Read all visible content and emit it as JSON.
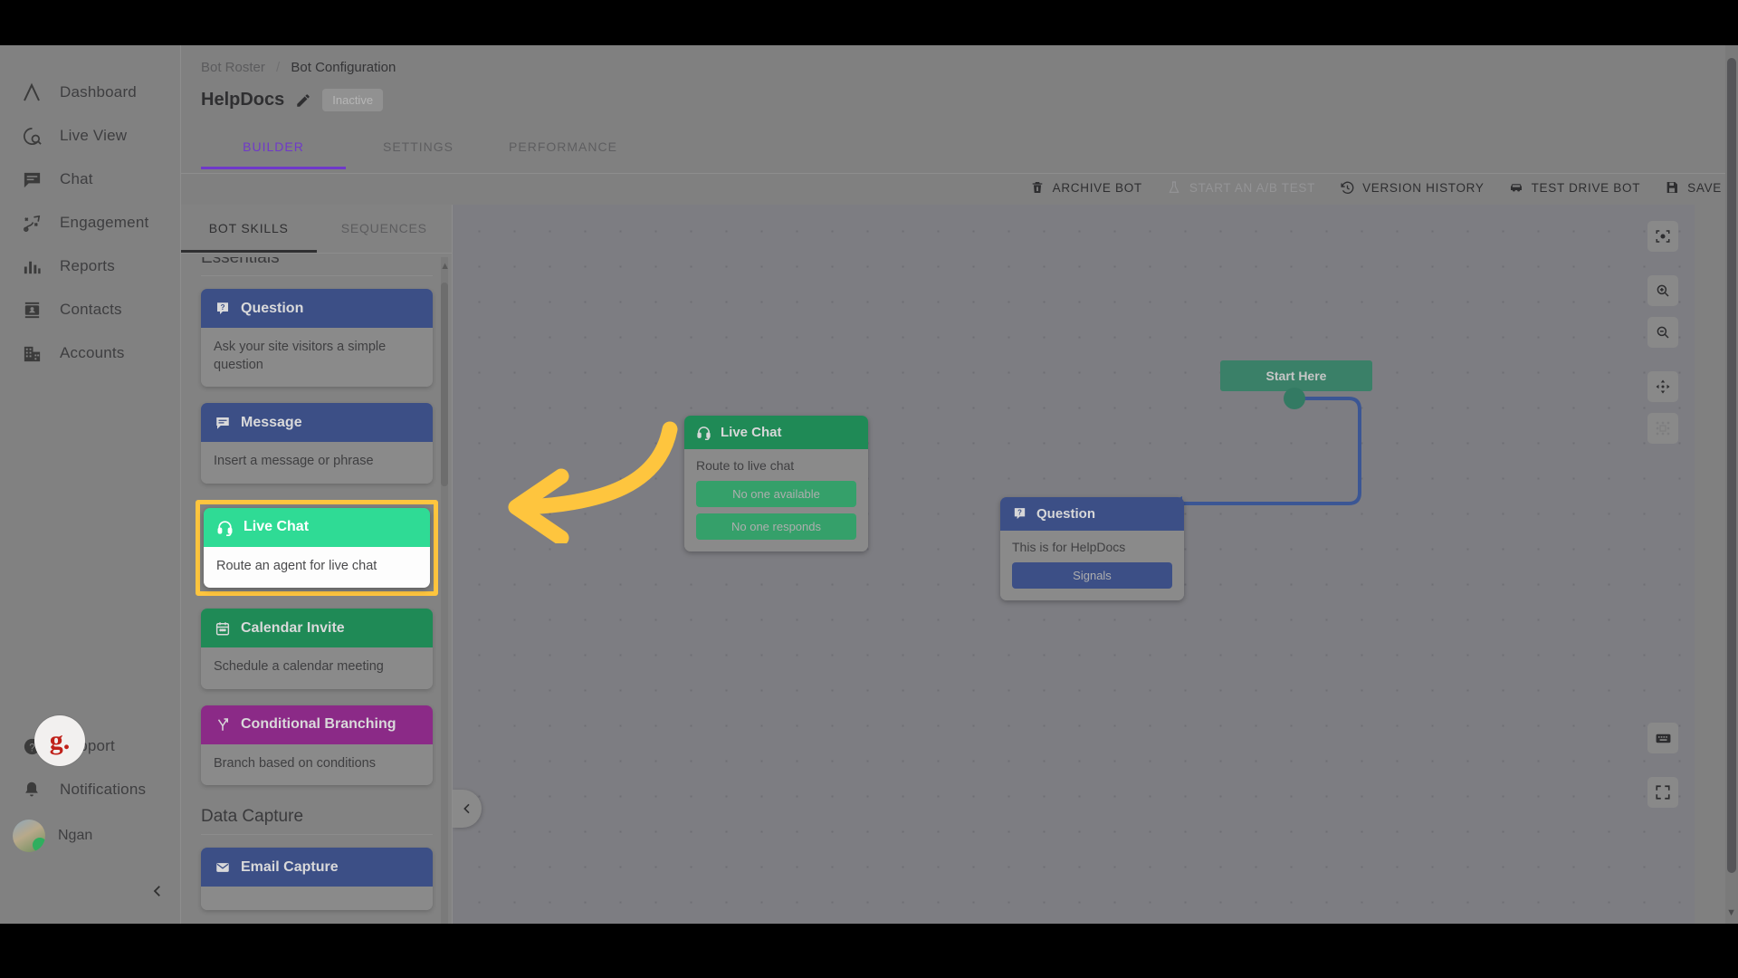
{
  "nav": {
    "top_items": [
      {
        "label": "Dashboard",
        "icon": "logo-caret-icon"
      },
      {
        "label": "Live View",
        "icon": "live-view-icon"
      },
      {
        "label": "Chat",
        "icon": "chat-bubble-icon"
      },
      {
        "label": "Engagement",
        "icon": "engagement-icon"
      },
      {
        "label": "Reports",
        "icon": "bar-chart-icon"
      },
      {
        "label": "Contacts",
        "icon": "contacts-card-icon"
      },
      {
        "label": "Accounts",
        "icon": "building-icon"
      }
    ],
    "bottom_items": [
      {
        "label": "Support",
        "icon": "help-circle-icon"
      },
      {
        "label": "Notifications",
        "icon": "bell-icon"
      }
    ],
    "user": {
      "name": "Ngan",
      "badge_letter": "g."
    },
    "collapse_icon": "chevron-left-icon"
  },
  "header": {
    "breadcrumb": {
      "parent": "Bot Roster",
      "separator": "/",
      "current": "Bot Configuration"
    },
    "title": "HelpDocs",
    "edit_icon": "pencil-icon",
    "status_badge": "Inactive",
    "tabs": [
      {
        "label": "BUILDER",
        "active": true
      },
      {
        "label": "SETTINGS",
        "active": false
      },
      {
        "label": "PERFORMANCE",
        "active": false
      }
    ],
    "accent_color": "#6f39c9"
  },
  "toolbar": {
    "buttons": [
      {
        "label": "ARCHIVE BOT",
        "icon": "trash-icon",
        "disabled": false
      },
      {
        "label": "START AN A/B TEST",
        "icon": "flask-icon",
        "disabled": true
      },
      {
        "label": "VERSION HISTORY",
        "icon": "clock-history-icon",
        "disabled": false
      },
      {
        "label": "TEST DRIVE BOT",
        "icon": "car-icon",
        "disabled": false
      },
      {
        "label": "SAVE",
        "icon": "floppy-disk-icon",
        "disabled": false
      }
    ]
  },
  "skills_panel": {
    "tabs": [
      {
        "label": "BOT SKILLS",
        "active": true
      },
      {
        "label": "SEQUENCES",
        "active": false
      }
    ],
    "sections": [
      {
        "heading": "Essentials",
        "cards": [
          {
            "title": "Question",
            "description": "Ask your site visitors a simple question",
            "icon": "question-badge-icon",
            "color": "#3c4f86",
            "highlighted": false
          },
          {
            "title": "Message",
            "description": "Insert a message or phrase",
            "icon": "message-lines-icon",
            "color": "#3c4f86",
            "highlighted": false
          },
          {
            "title": "Live Chat",
            "description": "Route an agent for live chat",
            "icon": "headset-icon",
            "color": "#2fdb95",
            "highlighted": true
          },
          {
            "title": "Calendar Invite",
            "description": "Schedule a calendar meeting",
            "icon": "calendar-icon",
            "color": "#1f8a56",
            "highlighted": false
          },
          {
            "title": "Conditional Branching",
            "description": "Branch based on conditions",
            "icon": "branch-icon",
            "color": "#8b2a87",
            "highlighted": false
          }
        ]
      },
      {
        "heading": "Data Capture",
        "cards": [
          {
            "title": "Email Capture",
            "description": "",
            "icon": "envelope-icon",
            "color": "#3c4f86",
            "highlighted": false
          }
        ]
      }
    ],
    "highlight_color": "#fec53e"
  },
  "canvas": {
    "start_node": {
      "label": "Start Here",
      "color": "#3a8068"
    },
    "nodes": [
      {
        "title": "Live Chat",
        "icon": "headset-icon",
        "color": "#1f8a56",
        "text": "Route to live chat",
        "buttons": [
          "No one available",
          "No one responds"
        ],
        "button_color": "#35a06a"
      },
      {
        "title": "Question",
        "icon": "question-badge-icon",
        "color": "#3c4f86",
        "text": "This is for HelpDocs",
        "buttons": [
          "Signals"
        ],
        "button_color": "#3c4f86"
      }
    ],
    "connector_color": "#3b5694",
    "collapse_icon": "chevron-left-icon",
    "tools_top": [
      {
        "icon": "center-focus-icon"
      },
      {
        "icon": "zoom-in-icon"
      },
      {
        "icon": "zoom-out-icon"
      },
      {
        "icon": "pan-move-icon"
      },
      {
        "icon": "snap-grid-icon"
      }
    ],
    "tools_bottom": [
      {
        "icon": "keyboard-icon"
      },
      {
        "icon": "fullscreen-icon"
      }
    ]
  },
  "annotation": {
    "arrow_color": "#fec53e",
    "direction": "points-left-to-live-chat-skill"
  }
}
